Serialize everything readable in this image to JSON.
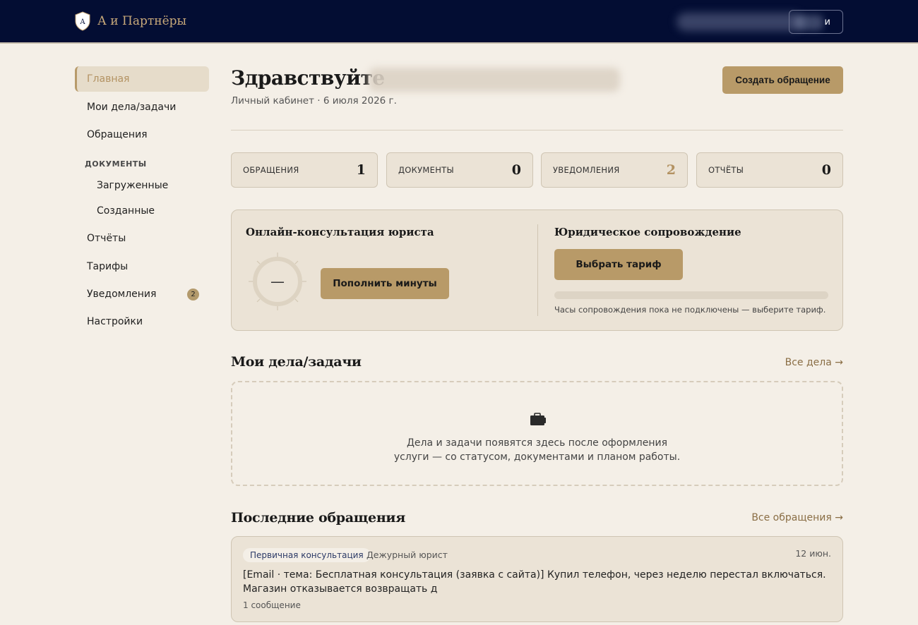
{
  "header": {
    "brand_name": "А и Партнёры",
    "logout_label": "и"
  },
  "sidebar": {
    "items": [
      {
        "label": "Главная"
      },
      {
        "label": "Мои дела/задачи"
      },
      {
        "label": "Обращения"
      },
      {
        "label": "Загруженные"
      },
      {
        "label": "Созданные"
      },
      {
        "label": "Отчёты"
      },
      {
        "label": "Тарифы"
      },
      {
        "label": "Уведомления",
        "badge": "2"
      },
      {
        "label": "Настройки"
      }
    ],
    "section_documents": "ДОКУМЕНТЫ"
  },
  "main": {
    "greeting": "Здравствуйте",
    "subline": "Личный кабинет · 6 июля 2026 г.",
    "create_button": "Создать обращение",
    "stats": [
      {
        "label": "ОБРАЩЕНИЯ",
        "value": "1"
      },
      {
        "label": "ДОКУМЕНТЫ",
        "value": "0"
      },
      {
        "label": "УВЕДОМЛЕНИЯ",
        "value": "2"
      },
      {
        "label": "ОТЧЁТЫ",
        "value": "0"
      }
    ],
    "consultation": {
      "title": "Онлайн-консультация юриста",
      "minutes_display": "—",
      "topup_button": "Пополнить минуты"
    },
    "support": {
      "title": "Юридическое сопровождение",
      "tariff_button": "Выбрать тариф",
      "hours_progress": 0,
      "note": "Часы сопровождения пока не подключены — выберите тариф."
    },
    "cases": {
      "title": "Мои дела/задачи",
      "link": "Все дела →",
      "empty_line1": "Дела и задачи появятся здесь после оформления",
      "empty_line2": "услуги — со статусом, документами и планом работы."
    },
    "requests": {
      "title": "Последние обращения",
      "link": "Все обращения →",
      "items": [
        {
          "tag": "Первичная консультация",
          "lawyer": "Дежурный юрист",
          "date": "12 июн.",
          "text": "[Email · тема: Бесплатная консультация (заявка с сайта)] Купил телефон, через неделю перестал включаться. Магазин отказывается возвращать д",
          "count": "1 сообщение"
        }
      ]
    }
  },
  "colors": {
    "header_bg": "#030d33",
    "accent_gold": "#b89a68",
    "page_bg": "#f4efe7",
    "card_bg": "#ebe3d6"
  }
}
